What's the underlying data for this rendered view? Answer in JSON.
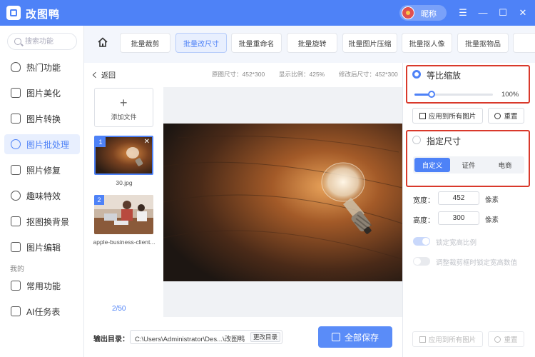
{
  "app": {
    "name": "改图鸭",
    "nickname": "昵称"
  },
  "window_controls": {
    "menu": "☰",
    "minimize": "—",
    "maximize": "☐",
    "close": "✕"
  },
  "search": {
    "placeholder": "搜索功能"
  },
  "sidebar": {
    "items": [
      {
        "label": "热门功能",
        "icon": "flame-icon"
      },
      {
        "label": "图片美化",
        "icon": "image-icon"
      },
      {
        "label": "图片转换",
        "icon": "convert-icon"
      },
      {
        "label": "图片批处理",
        "icon": "batch-icon",
        "active": true
      },
      {
        "label": "照片修复",
        "icon": "repair-icon"
      },
      {
        "label": "趣味特效",
        "icon": "sparkle-icon"
      },
      {
        "label": "抠图换背景",
        "icon": "cutout-icon"
      },
      {
        "label": "图片编辑",
        "icon": "edit-icon"
      }
    ],
    "section_label": "我的",
    "mine_items": [
      {
        "label": "常用功能",
        "icon": "grid-icon"
      },
      {
        "label": "AI任务表",
        "icon": "task-list-icon"
      }
    ]
  },
  "tabs": [
    {
      "label": "批量裁剪"
    },
    {
      "label": "批量改尺寸",
      "active": true
    },
    {
      "label": "批量重命名"
    },
    {
      "label": "批量旋转"
    },
    {
      "label": "批量图片压缩"
    },
    {
      "label": "批量抠人像"
    },
    {
      "label": "批量抠物品"
    }
  ],
  "workspace": {
    "back_label": "返回",
    "original_size": "原图尺寸：452*300",
    "display_ratio": "显示比例：425%",
    "modified_size": "修改后尺寸：452*300",
    "add_file_label": "添加文件",
    "files": [
      {
        "number": "1",
        "name": "30.jpg",
        "selected": true
      },
      {
        "number": "2",
        "name": "apple-business-client..."
      }
    ],
    "page_count": "2/50",
    "output_label": "输出目录：",
    "output_path": "C:\\Users\\Administrator\\Des...\\改图鸭",
    "change_dir_label": "更改目录",
    "save_all_label": "全部保存"
  },
  "panel": {
    "proportional_label": "等比缩放",
    "scale_percent": 100,
    "scale_value": "100%",
    "apply_all_label": "应用到所有图片",
    "reset_label": "重置",
    "specified_label": "指定尺寸",
    "segments": [
      {
        "label": "自定义",
        "active": true
      },
      {
        "label": "证件"
      },
      {
        "label": "电商"
      }
    ],
    "width_label": "宽度：",
    "width_value": "452",
    "height_label": "高度：",
    "height_value": "300",
    "unit": "像素",
    "lock_ratio_label": "锁定宽高比例",
    "lock_crop_label": "调整裁剪框时锁定宽高数值"
  },
  "colors": {
    "accent": "#4e82f7",
    "highlight": "#d9392b"
  }
}
